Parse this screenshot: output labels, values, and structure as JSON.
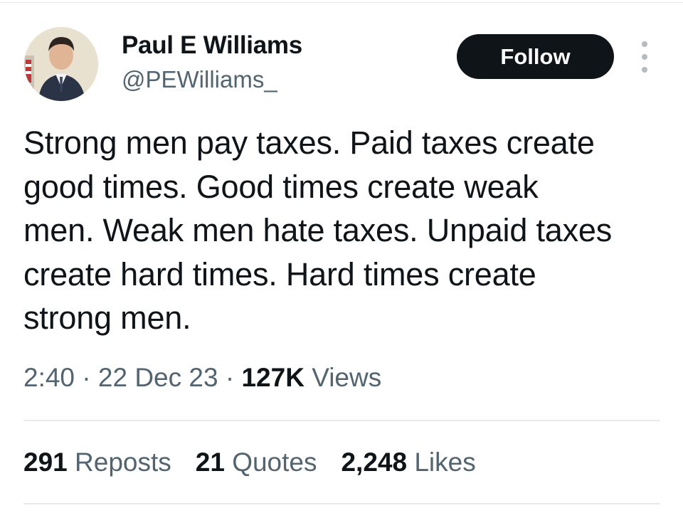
{
  "user": {
    "display_name": "Paul E Williams",
    "handle": "@PEWilliams_"
  },
  "actions": {
    "follow_label": "Follow"
  },
  "tweet": {
    "lines": [
      "Strong men pay taxes. Paid taxes create",
      "good times. Good times create weak",
      "men. Weak men hate taxes. Unpaid taxes",
      "create hard times. Hard times create",
      "strong men."
    ]
  },
  "meta": {
    "time": "2:40",
    "separator": " · ",
    "date": "22 Dec 23",
    "views_count": "127K",
    "views_label": "Views"
  },
  "stats": {
    "reposts_count": "291",
    "reposts_label": "Reposts",
    "quotes_count": "21",
    "quotes_label": "Quotes",
    "likes_count": "2,248",
    "likes_label": "Likes"
  },
  "colors": {
    "text_primary": "#0f1419",
    "text_secondary": "#536471",
    "button_bg": "#0f1419",
    "divider": "#e7eaed"
  },
  "icons": {
    "more": "more-vertical-icon"
  }
}
